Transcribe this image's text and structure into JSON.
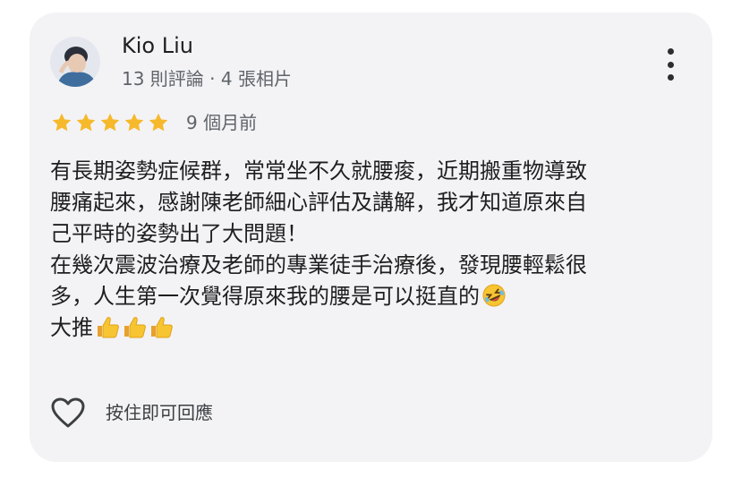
{
  "reviewer": {
    "name": "Kio Liu",
    "meta": "13 則評論 · 4 張相片"
  },
  "review": {
    "rating": 5,
    "max_rating": 5,
    "time": "9 個月前",
    "lines": [
      "有長期姿勢症候群，常常坐不久就腰痠，近期搬重物導致",
      "腰痛起來，感謝陳老師細心評估及講解，我才知道原來自",
      "己平時的姿勢出了大問題！",
      "在幾次震波治療及老師的專業徒手治療後，發現腰輕鬆很",
      "多，人生第一次覺得原來我的腰是可以挺直的",
      "大推"
    ],
    "emoji": {
      "line5": "rolling-on-floor-laughing-emoji",
      "line6": [
        "thumbs-up-emoji",
        "thumbs-up-emoji",
        "thumbs-up-emoji"
      ]
    }
  },
  "actions": {
    "like_icon": "heart-outline-icon",
    "reply_label": "按住即可回應",
    "more_icon": "more-vertical-icon"
  },
  "colors": {
    "card_bg": "#f3f3f6",
    "star": "#f6b92b",
    "secondary_text": "#5f6368"
  }
}
